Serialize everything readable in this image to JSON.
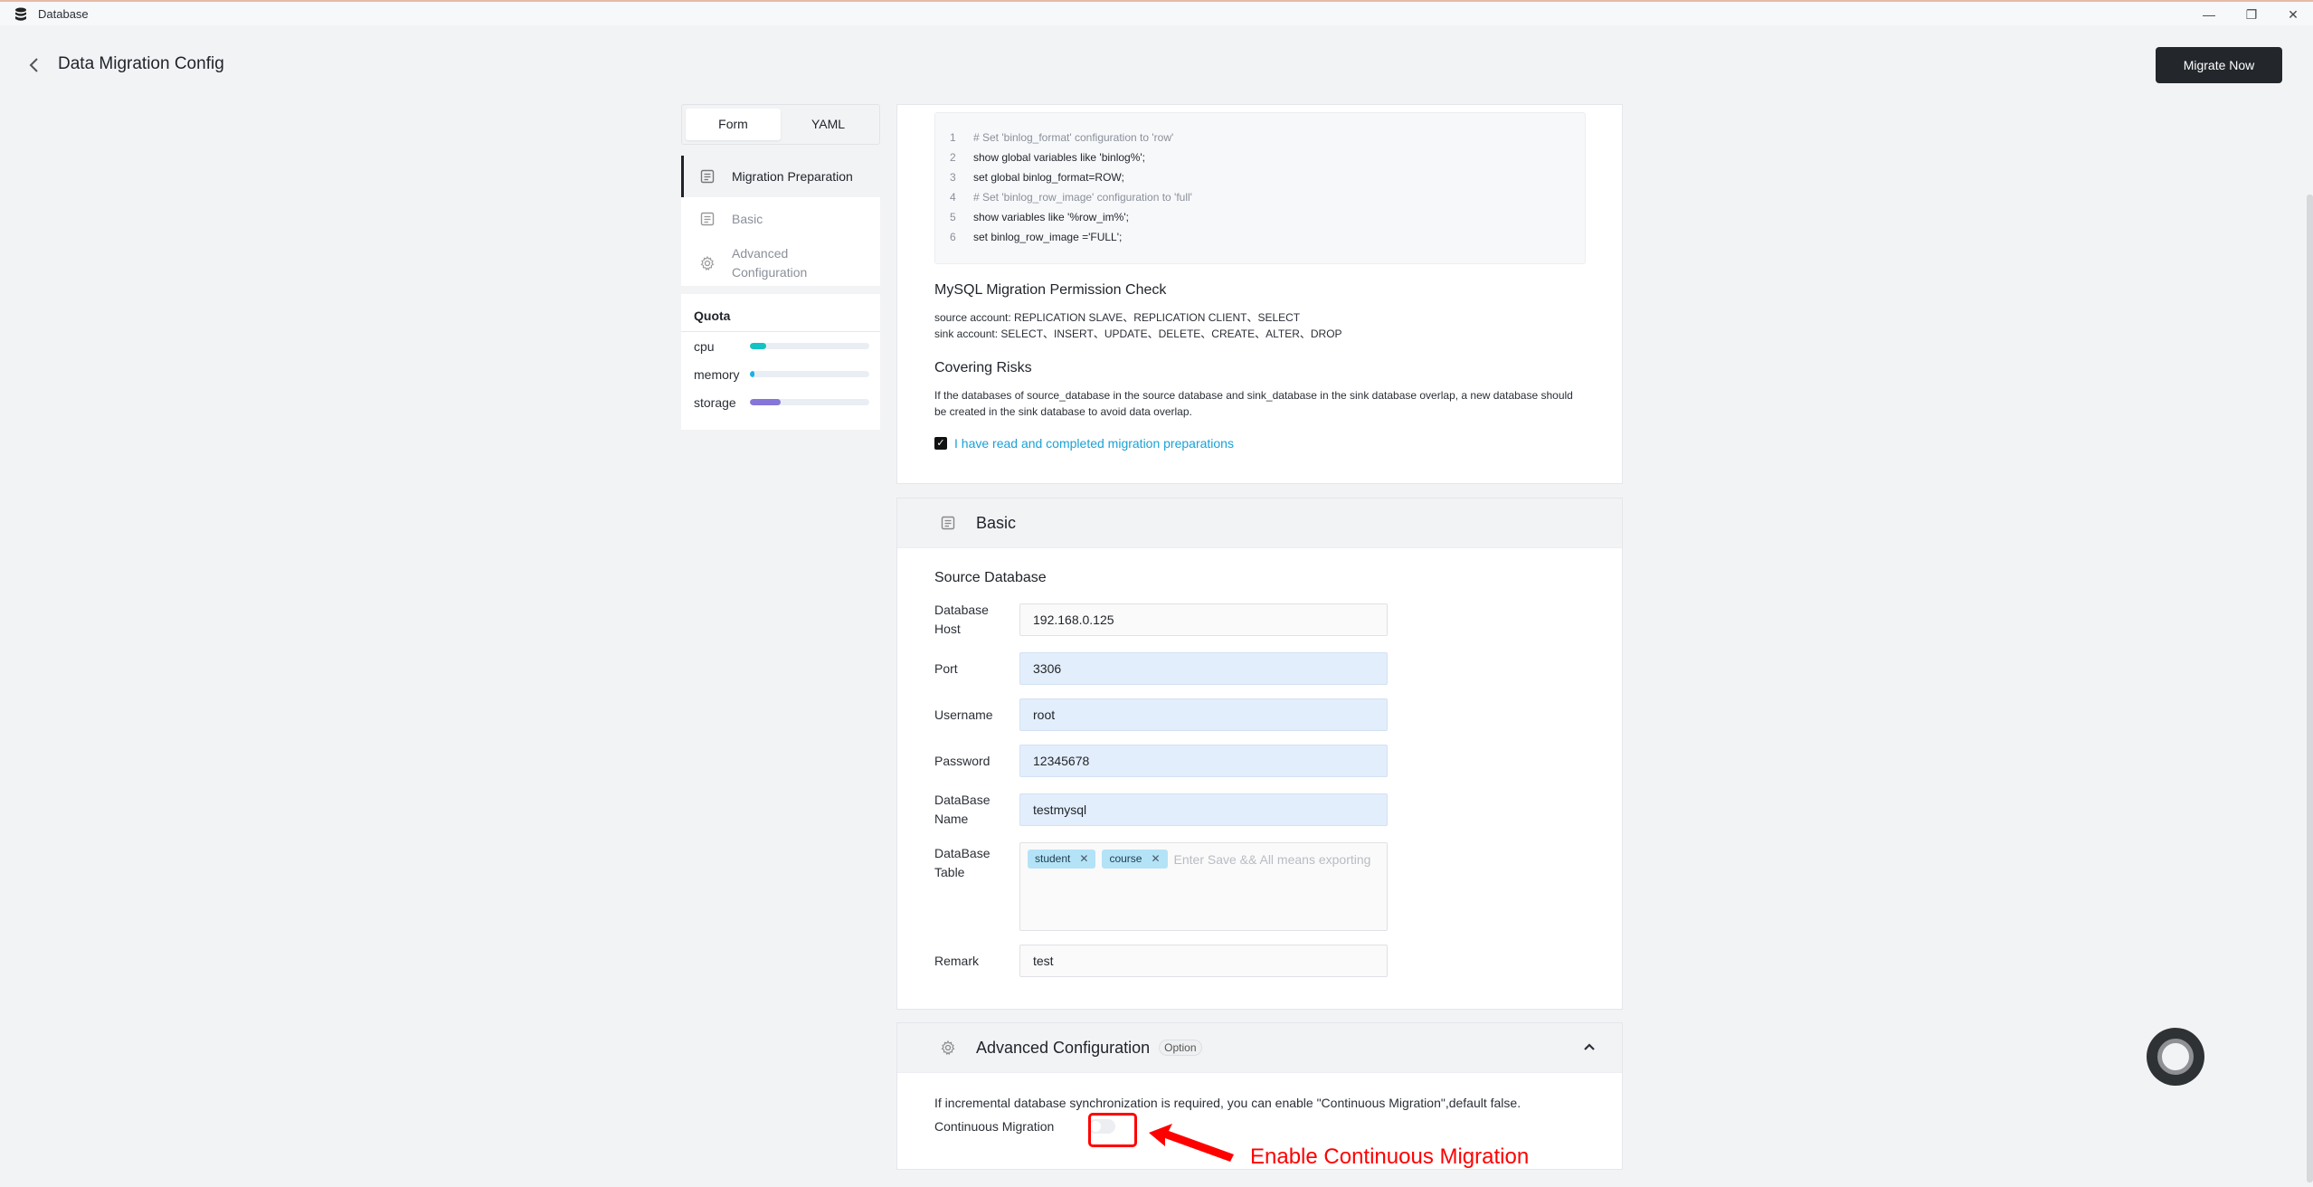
{
  "window": {
    "app_title": "Database",
    "controls": {
      "minimize": "—",
      "maximize": "❐",
      "close": "✕"
    }
  },
  "header": {
    "title": "Data Migration Config",
    "primary_button": "Migrate Now"
  },
  "mode_tabs": [
    {
      "label": "Form",
      "active": true
    },
    {
      "label": "YAML",
      "active": false
    }
  ],
  "nav": {
    "items": [
      {
        "label": "Migration Preparation",
        "icon": "document-icon",
        "active": true
      },
      {
        "label": "Basic",
        "icon": "document-icon",
        "active": false
      },
      {
        "label": "Advanced Configuration",
        "icon": "gear-icon",
        "active": false
      }
    ]
  },
  "quota": {
    "title": "Quota",
    "items": [
      {
        "label": "cpu",
        "percent": 14,
        "color": "#13c2c2"
      },
      {
        "label": "memory",
        "percent": 4,
        "color": "#1ab1e8"
      },
      {
        "label": "storage",
        "percent": 26,
        "color": "#8676d9"
      }
    ]
  },
  "preparation": {
    "code_lines": [
      {
        "num": "1",
        "text": "# Set 'binlog_format' configuration to 'row'",
        "comment": true
      },
      {
        "num": "2",
        "text": "show global variables like 'binlog%';",
        "comment": false
      },
      {
        "num": "3",
        "text": "set global binlog_format=ROW;",
        "comment": false
      },
      {
        "num": "4",
        "text": "# Set 'binlog_row_image' configuration to 'full'",
        "comment": true
      },
      {
        "num": "5",
        "text": "show variables like '%row_im%';",
        "comment": false
      },
      {
        "num": "6",
        "text": "set binlog_row_image ='FULL';",
        "comment": false
      }
    ],
    "permission_title": "MySQL Migration Permission Check",
    "source_account": "source account: REPLICATION SLAVE、REPLICATION CLIENT、SELECT",
    "sink_account": "sink account: SELECT、INSERT、UPDATE、DELETE、CREATE、ALTER、DROP",
    "risks_title": "Covering Risks",
    "risks_text": "If the databases of source_database in the source database and sink_database in the sink database overlap, a new database should be created in the sink database to avoid data overlap.",
    "confirm_checked": true,
    "confirm_label": "I have read and completed migration preparations"
  },
  "basic": {
    "title": "Basic",
    "subtitle": "Source Database",
    "fields": {
      "host": {
        "label": "Database Host",
        "value": "192.168.0.125"
      },
      "port": {
        "label": "Port",
        "value": "3306"
      },
      "username": {
        "label": "Username",
        "value": "root"
      },
      "password": {
        "label": "Password",
        "value": "12345678"
      },
      "dbname": {
        "label": "DataBase Name",
        "value": "testmysql"
      },
      "table": {
        "label": "DataBase Table",
        "tags": [
          "student",
          "course"
        ],
        "placeholder": "Enter Save && All means exporting"
      },
      "remark": {
        "label": "Remark",
        "value": "test"
      }
    }
  },
  "advanced": {
    "title": "Advanced Configuration",
    "badge": "Option",
    "description": "If incremental database synchronization is required, you can enable \"Continuous Migration\",default false.",
    "continuous_label": "Continuous Migration",
    "continuous_enabled": false
  },
  "annotation": {
    "text": "Enable Continuous Migration",
    "color": "#ff0000"
  }
}
